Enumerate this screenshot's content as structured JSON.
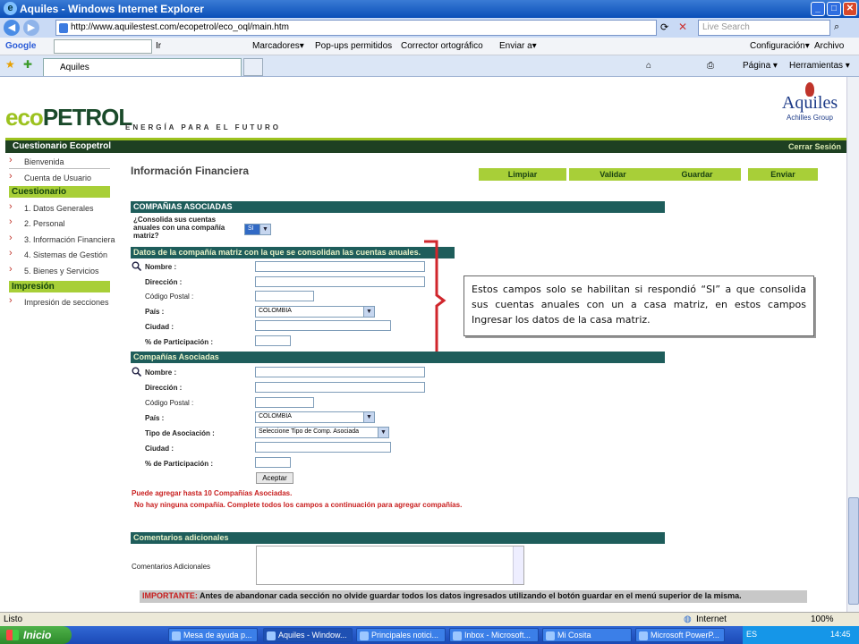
{
  "window": {
    "title": "Aquiles - Windows Internet Explorer",
    "minimize": "_",
    "maximize": "□",
    "close": "✕"
  },
  "address_bar": {
    "url": "http://www.aquilestest.com/ecopetrol/eco_oql/main.htm",
    "search_placeholder": "Live Search"
  },
  "google_bar": {
    "logo": "Google",
    "marcadores": "Marcadores▾",
    "popups": "Pop-ups permitidos",
    "corrector": "Corrector ortográfico",
    "enviar": "Enviar a▾",
    "configuracion": "Configuración▾",
    "archivo": "Archivo",
    "ir": "Ir"
  },
  "tabs": {
    "active_tab": "Aquiles",
    "pagina": "Página ▾",
    "herramientas": "Herramientas ▾"
  },
  "header": {
    "eco": "eco",
    "petrol": "PETROL",
    "tagline": "ENERGÍA PARA EL FUTURO",
    "achilles_name": "Aquiles",
    "achilles_group": "Achilles Group",
    "bar_left": "Cuestionario Ecopetrol",
    "bar_right": "Cerrar Sesión"
  },
  "sidebar": {
    "items_top": [
      "Bienvenida",
      "Cuenta de Usuario"
    ],
    "cuestionario_head": "Cuestionario",
    "cuestionario_items": [
      "1. Datos Generales",
      "2. Personal",
      "3. Información Financiera",
      "4. Sistemas de Gestión",
      "5. Bienes y Servicios"
    ],
    "impresion_head": "Impresión",
    "impresion_items": [
      "Impresión de secciones"
    ]
  },
  "content": {
    "title": "Información Financiera",
    "buttons": [
      "Limpiar",
      "Validar",
      "Guardar",
      "Enviar"
    ],
    "sec_asociadas": "COMPAÑIAS ASOCIADAS",
    "consolida_q": "¿Consolida sus cuentas anuales con una compañía matriz?",
    "consolida_val": "SI",
    "sec_matriz": "Datos de la compañía matriz con la que se consolidan las cuentas anuales.",
    "matriz_labels": [
      "Nombre :",
      "Dirección :",
      "Código Postal :",
      "País :",
      "Ciudad :",
      "% de Participación :"
    ],
    "pais_val": "COLOMBIA",
    "sec_asoc2": "Compañías Asociadas",
    "asoc_labels": [
      "Nombre :",
      "Dirección :",
      "Código Postal :",
      "País :",
      "Tipo de Asociación :",
      "Ciudad :",
      "% de Participación :"
    ],
    "tipo_val": "Seleccione Tipo de Comp. Asociada",
    "aceptar": "Aceptar",
    "red1": "Puede agregar hasta 10 Compañías Asociadas.",
    "red2": "No hay ninguna compañía. Complete todos los campos a continuación para agregar compañías.",
    "sec_comentarios": "Comentarios adicionales",
    "comentarios_label": "Comentarios Adicionales",
    "important_red": "IMPORTANTE:",
    "important_text": " Antes de abandonar cada sección no olvide guardar todos los datos ingresados utilizando el botón guardar en el menú superior de la misma."
  },
  "callout": {
    "text": "Estos campos solo se habilitan si respondió “SI” a que consolida sus cuentas anuales con un a casa matriz, en estos campos Ingresar los datos de la casa matriz."
  },
  "status": {
    "left": "Listo",
    "zone": "Internet",
    "zoom": "100%"
  },
  "taskbar": {
    "start": "Inicio",
    "tasks": [
      "Mesa de ayuda p...",
      "Aquiles - Window...",
      "Principales notici...",
      "Inbox - Microsoft...",
      "Mi Cosita",
      "Microsoft PowerP..."
    ],
    "lang": "ES",
    "time": "14:45"
  },
  "colors": {
    "green_accent": "#a8cf38",
    "section_teal": "#1e5d5b",
    "header_green": "#1e4022",
    "bracket_red": "#d0262c"
  }
}
